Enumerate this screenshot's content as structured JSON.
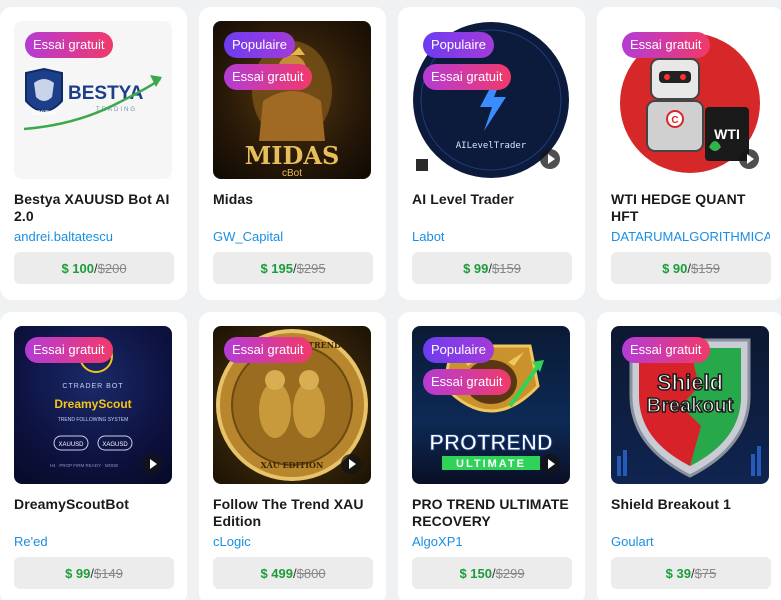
{
  "products": [
    {
      "title": "Bestya XAUUSD Bot AI 2.0",
      "author": "andrei.baltatescu",
      "price": "$ 100",
      "old_price": "$200",
      "badges": [
        "Essai gratuit"
      ],
      "image_text": [
        "BESTYA",
        "TRADING",
        "BESTYA"
      ]
    },
    {
      "title": "Midas",
      "author": "GW_Capital",
      "price": "$ 195",
      "old_price": "$295",
      "badges": [
        "Populaire",
        "Essai gratuit"
      ],
      "image_text": [
        "MIDAS",
        "cBot"
      ]
    },
    {
      "title": "AI Level Trader",
      "author": "Labot",
      "price": "$ 99",
      "old_price": "$159",
      "badges": [
        "Populaire",
        "Essai gratuit"
      ],
      "image_text": [
        "AILevelTrader"
      ]
    },
    {
      "title": "WTI HEDGE QUANT HFT",
      "author": "DATARUMALGORITHMICA",
      "price": "$ 90",
      "old_price": "$159",
      "badges": [
        "Essai gratuit"
      ],
      "image_text": [
        "WTI",
        "C"
      ]
    },
    {
      "title": "DreamyScoutBot",
      "author": "Re'ed",
      "price": "$ 99",
      "old_price": "$149",
      "badges": [
        "Essai gratuit"
      ],
      "image_text": [
        "CTRADER BOT",
        "DreamyScout",
        "TREND FOLLOWING SYSTEM",
        "XAUUSD",
        "XAGUSD",
        "H4 · PROP FIRM READY · MODE"
      ]
    },
    {
      "title": "Follow The Trend XAU Edition",
      "author": "cLogic",
      "price": "$ 499",
      "old_price": "$800",
      "badges": [
        "Essai gratuit"
      ],
      "image_text": [
        "FOLLOW THE TREND",
        "XAU EDITION"
      ]
    },
    {
      "title": "PRO TREND ULTIMATE RECOVERY",
      "author": "AlgoXP1",
      "price": "$ 150",
      "old_price": "$299",
      "badges": [
        "Populaire",
        "Essai gratuit"
      ],
      "image_text": [
        "PROTREND",
        "ULTIMATE"
      ]
    },
    {
      "title": "Shield Breakout 1",
      "author": "Goulart",
      "price": "$ 39",
      "old_price": "$75",
      "badges": [
        "Essai gratuit"
      ],
      "image_text": [
        "Shield",
        "Breakout"
      ]
    }
  ],
  "price_separator": "/ ",
  "colors": {
    "price_now": "#1b9e3a",
    "author": "#1a8fe0",
    "badge_trial": "#e03a8a",
    "badge_popular": "#7a3ce8"
  }
}
